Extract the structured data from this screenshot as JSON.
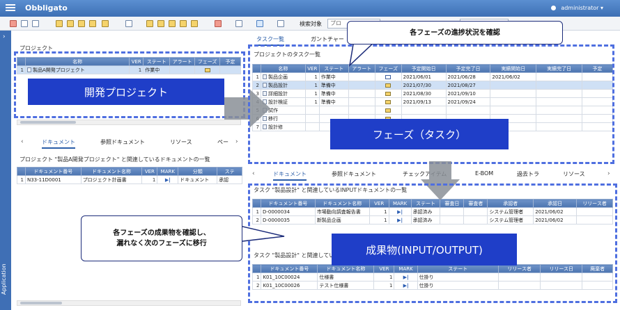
{
  "app": {
    "title": "Obbligato",
    "user": "administrator ▾",
    "sidebar_label": "Application"
  },
  "toolbar": {
    "search_label": "検索対象",
    "search_value": "プロ"
  },
  "project_panel": {
    "title": "プロジェクト",
    "columns": [
      "名称",
      "VER",
      "ステート",
      "アラート",
      "フェーズ",
      "予定"
    ],
    "rows": [
      {
        "no": "1",
        "name": "製品A開発プロジェクト",
        "ver": "1",
        "state": "作業中"
      }
    ]
  },
  "left_tabs": [
    "ドキュメント",
    "参照ドキュメント",
    "リソース",
    "ペー"
  ],
  "left_doc": {
    "title": "プロジェクト \"製品A開発プロジェクト\" と関連しているドキュメントの一覧",
    "columns": [
      "ドキュメント番号",
      "ドキュメント名称",
      "VER",
      "MARK",
      "分類",
      "ステ"
    ],
    "rows": [
      {
        "no": "1",
        "docno": "N33-11D0001",
        "name": "プロジェクト計画書",
        "ver": "1",
        "mark": "▶|",
        "cat": "ドキュメント",
        "state": "承認"
      }
    ]
  },
  "right_tabs_top": [
    "タスク一覧",
    "ガントチャー"
  ],
  "task_panel": {
    "title": "プロジェクトのタスク一覧",
    "columns": [
      "名称",
      "VER",
      "ステート",
      "アラート",
      "フェーズ",
      "予定開始日",
      "予定完了日",
      "実績開始日",
      "実績完了日",
      "予定"
    ],
    "rows": [
      {
        "no": "1",
        "name": "製品企画",
        "ver": "1",
        "state": "作業中",
        "phase": "wip",
        "ps": "2021/06/01",
        "pe": "2021/06/28",
        "as": "2021/06/02"
      },
      {
        "no": "2",
        "name": "製品設計",
        "ver": "1",
        "state": "準備中",
        "phase": "done",
        "ps": "2021/07/30",
        "pe": "2021/08/27",
        "as": ""
      },
      {
        "no": "3",
        "name": "詳細設計",
        "ver": "1",
        "state": "準備中",
        "phase": "done",
        "ps": "2021/08/30",
        "pe": "2021/09/10",
        "as": ""
      },
      {
        "no": "4",
        "name": "設計検証",
        "ver": "1",
        "state": "準備中",
        "phase": "done",
        "ps": "2021/09/13",
        "pe": "2021/09/24",
        "as": ""
      },
      {
        "no": "5",
        "name": "試作",
        "ver": "",
        "state": "",
        "phase": "done",
        "ps": "",
        "pe": "",
        "as": ""
      },
      {
        "no": "6",
        "name": "移行",
        "ver": "",
        "state": "",
        "phase": "done",
        "ps": "",
        "pe": "",
        "as": ""
      },
      {
        "no": "7",
        "name": "設計修",
        "ver": "",
        "state": "",
        "phase": "",
        "ps": "",
        "pe": "",
        "as": ""
      }
    ]
  },
  "right_tabs_bottom": [
    "ドキュメント",
    "参照ドキュメント",
    "チェックアイテム",
    "E-BOM",
    "過去トラ",
    "リソース"
  ],
  "input_docs": {
    "title": "タスク \"製品設計\" と関連しているINPUTドキュメントの一覧",
    "columns": [
      "ドキュメント番号",
      "ドキュメント名称",
      "VER",
      "MARK",
      "ステート",
      "審査日",
      "審査者",
      "承認者",
      "承認日",
      "リリース者"
    ],
    "rows": [
      {
        "no": "1",
        "docno": "D-0000034",
        "name": "市場動向調査報告書",
        "ver": "1",
        "mark": "▶|",
        "state": "承認済み",
        "approver": "システム管理者",
        "date": "2021/06/02"
      },
      {
        "no": "2",
        "docno": "D-0000035",
        "name": "新製品企画",
        "ver": "1",
        "mark": "▶|",
        "state": "承認済み",
        "approver": "システム管理者",
        "date": "2021/06/02"
      }
    ]
  },
  "output_docs": {
    "title": "タスク \"製品設計\" と関連してい",
    "columns": [
      "ドキュメント番号",
      "ドキュメント名称",
      "VER",
      "MARK",
      "ステート",
      "リリース者",
      "リリース日",
      "廃棄者"
    ],
    "rows": [
      {
        "no": "1",
        "docno": "K01_10C00024",
        "name": "仕様書",
        "ver": "1",
        "mark": "▶|",
        "state": "仕掛り"
      },
      {
        "no": "2",
        "docno": "K01_10C00026",
        "name": "テスト仕様書",
        "ver": "1",
        "mark": "▶|",
        "state": "仕掛り"
      }
    ]
  },
  "annotations": {
    "project": "開発プロジェクト",
    "phase": "フェーズ（タスク）",
    "deliverable": "成果物(INPUT/OUTPUT)",
    "bubble_top": "各フェーズの進捗状況を確認",
    "bubble_left_1": "各フェーズの成果物を確認し、",
    "bubble_left_2": "漏れなく次のフェーズに移行"
  },
  "colors": {
    "header": "#4a7cc0",
    "annotation_blue": "#1f3ec8",
    "dashed": "#4f6fe0"
  }
}
